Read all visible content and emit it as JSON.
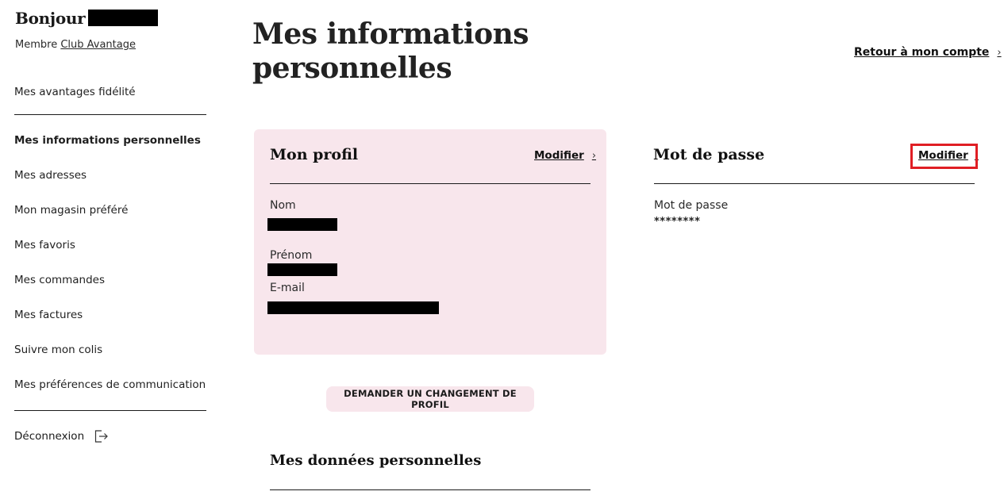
{
  "sidebar": {
    "greeting": "Bonjour",
    "member_prefix": "Membre",
    "member_club": "Club Avantage",
    "items": [
      {
        "label": "Mes avantages fidélité"
      },
      {
        "label": "Mes informations personnelles"
      },
      {
        "label": "Mes adresses"
      },
      {
        "label": "Mon magasin préféré"
      },
      {
        "label": "Mes favoris"
      },
      {
        "label": "Mes commandes"
      },
      {
        "label": "Mes factures"
      },
      {
        "label": "Suivre mon colis"
      },
      {
        "label": "Mes préférences de communication"
      }
    ],
    "active_item": "Mes informations personnelles",
    "logout_label": "Déconnexion",
    "logout_icon": "logout-icon"
  },
  "header": {
    "title": "Mes informations personnelles",
    "back_link": "Retour à mon compte"
  },
  "profile": {
    "title": "Mon profil",
    "modify_label": "Modifier",
    "fields": {
      "nom_label": "Nom",
      "prenom_label": "Prénom",
      "email_label": "E-mail"
    }
  },
  "password": {
    "title": "Mot de passe",
    "modify_label": "Modifier",
    "field_label": "Mot de passe",
    "value": "********"
  },
  "change_button": "DEMANDER UN CHANGEMENT DE PROFIL",
  "personal_data": {
    "title": "Mes données personnelles"
  },
  "colors": {
    "card_background": "#f8e6ec",
    "highlight": "#e01e24",
    "text": "#1a1a1a"
  },
  "chevron": "›"
}
